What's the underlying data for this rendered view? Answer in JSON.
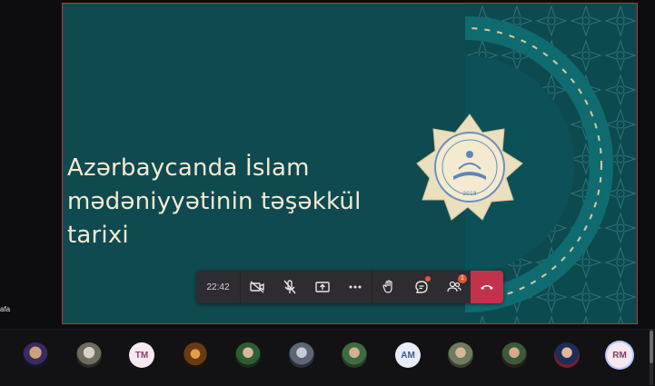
{
  "slide": {
    "title_lines": [
      "Azərbaycanda İslam",
      "mədəniyyətinin təşəkkül",
      "tarixi"
    ],
    "emblem_text_top": "AZƏRBAYCAN İLAHİYYAT İNSTİTUTU",
    "emblem_text_bottom": "AZERBAIJAN INSTITUTE OF THEOLOGY",
    "emblem_year": "2018"
  },
  "participant_name_fragment": "afa",
  "toolbar": {
    "timer": "22:42",
    "buttons": [
      {
        "name": "camera-off",
        "icon": "video-off-icon"
      },
      {
        "name": "mic-off",
        "icon": "mic-off-icon"
      },
      {
        "name": "share",
        "icon": "share-screen-icon"
      },
      {
        "name": "more",
        "icon": "more-icon"
      },
      {
        "name": "raise-hand",
        "icon": "hand-icon"
      },
      {
        "name": "chat",
        "icon": "chat-icon"
      },
      {
        "name": "participants",
        "icon": "people-icon"
      }
    ],
    "participants_badge": "1",
    "hangup_icon": "phone-hangup-icon",
    "colors": {
      "bar": "#2d2d31",
      "hangup": "#c4314b",
      "badge": "#e0573b"
    }
  },
  "tray": {
    "avatars": [
      {
        "kind": "photo",
        "style": "ph1"
      },
      {
        "kind": "photo",
        "style": "ph2"
      },
      {
        "kind": "initials",
        "text": "TM"
      },
      {
        "kind": "photo",
        "style": "ph3"
      },
      {
        "kind": "photo",
        "style": "ph4"
      },
      {
        "kind": "photo",
        "style": "ph5"
      },
      {
        "kind": "photo",
        "style": "ph6"
      },
      {
        "kind": "initials",
        "text": "AM"
      },
      {
        "kind": "photo",
        "style": "ph7"
      },
      {
        "kind": "photo",
        "style": "ph8"
      },
      {
        "kind": "photo",
        "style": "ph9"
      },
      {
        "kind": "initials",
        "text": "RM"
      }
    ]
  }
}
